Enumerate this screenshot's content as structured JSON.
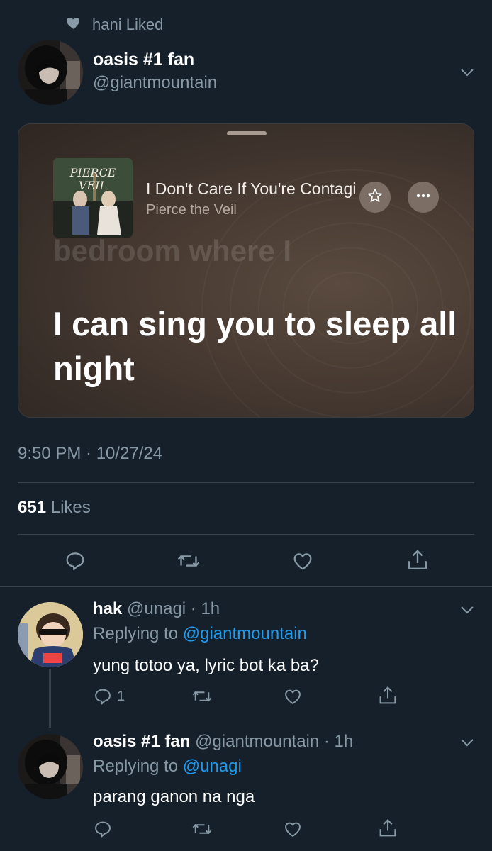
{
  "social_context": {
    "text": "hani Liked"
  },
  "main_tweet": {
    "name": "oasis #1 fan",
    "handle": "@giantmountain",
    "card": {
      "song_title": "I Don't Care If You're Contagious",
      "artist": "Pierce the Veil",
      "previous_lyric": "bedroom where I",
      "current_lyric": "I can sing you to sleep all night",
      "album_text": "PIERCE THE VEIL"
    },
    "timestamp": "9:50 PM · 10/27/24",
    "likes_count": "651",
    "likes_label": "Likes"
  },
  "replies": [
    {
      "name": "hak",
      "handle": "@unagi",
      "time": "· 1h",
      "replying_prefix": "Replying to",
      "replying_to": "@giantmountain",
      "text": "yung totoo ya, lyric bot ka ba?",
      "reply_count": "1"
    },
    {
      "name": "oasis #1 fan",
      "handle": "@giantmountain",
      "time": "· 1h",
      "replying_prefix": "Replying to",
      "replying_to": "@unagi",
      "text": "parang ganon na nga",
      "reply_count": ""
    }
  ],
  "colors": {
    "background": "#15202b",
    "muted": "#8899a6",
    "link": "#1d9bf0",
    "divider": "#38444d"
  },
  "icons": [
    "heart-icon",
    "chevron-down-icon",
    "star-icon",
    "more-icon",
    "reply-icon",
    "retweet-icon",
    "like-icon",
    "share-icon"
  ]
}
